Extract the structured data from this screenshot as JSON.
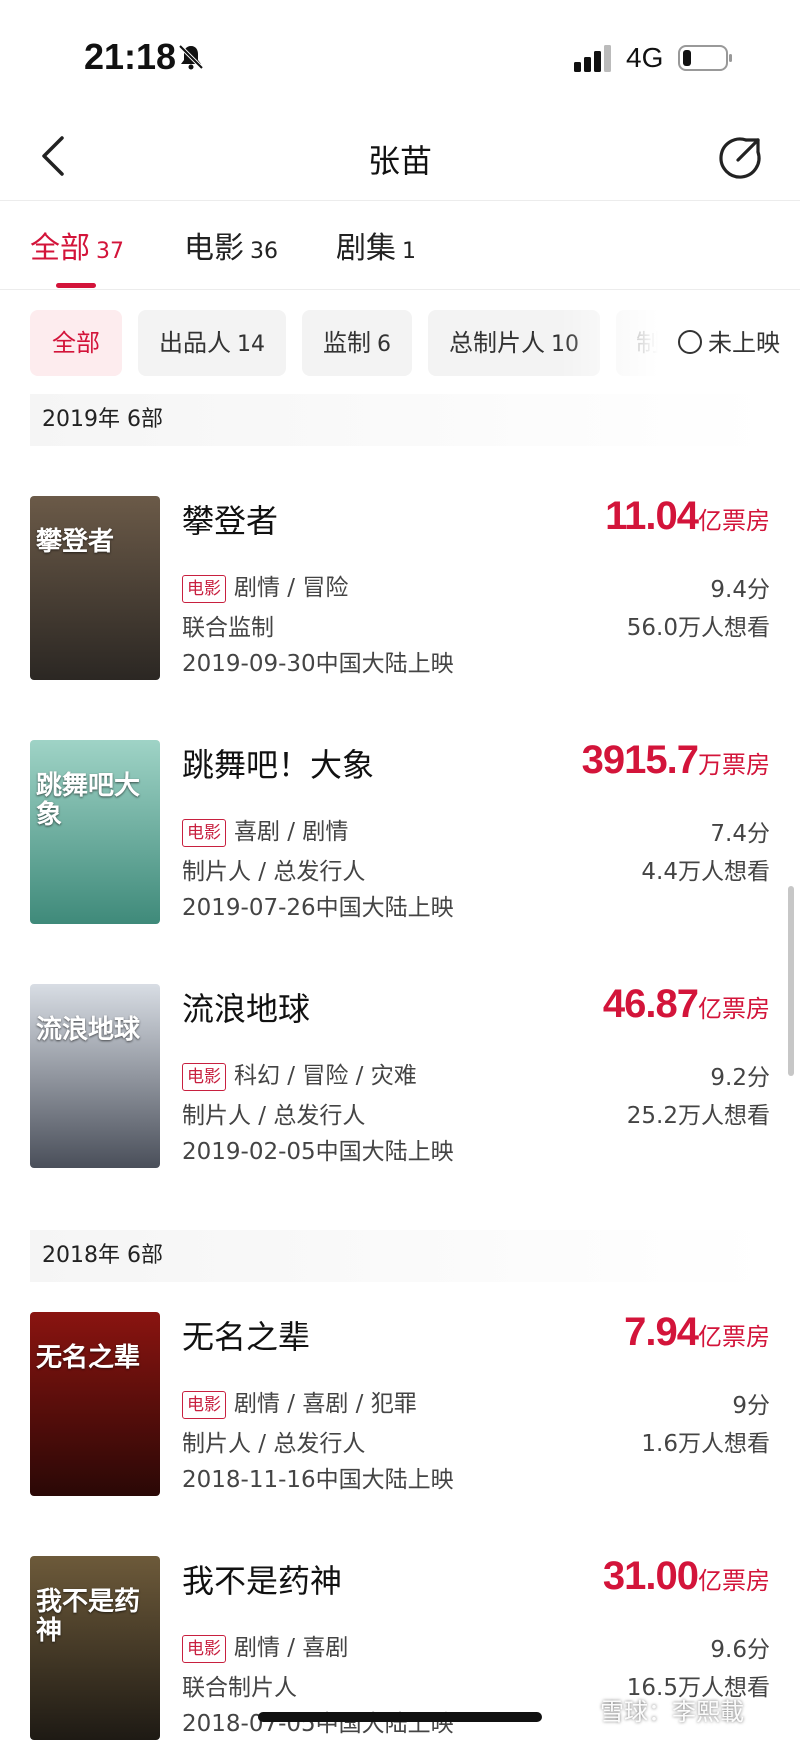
{
  "status_bar": {
    "time": "21:18",
    "network": "4G",
    "icons": [
      "bell-off-icon",
      "signal-icon",
      "battery-icon"
    ]
  },
  "nav": {
    "title": "张苗",
    "icons": [
      "back-icon",
      "share-icon"
    ]
  },
  "tabs": [
    {
      "label": "全部",
      "count": "37"
    },
    {
      "label": "电影",
      "count": "36"
    },
    {
      "label": "剧集",
      "count": "1"
    }
  ],
  "filters": [
    {
      "label": "全部",
      "count": ""
    },
    {
      "label": "出品人",
      "count": "14"
    },
    {
      "label": "监制",
      "count": "6"
    },
    {
      "label": "总制片人",
      "count": "10"
    },
    {
      "label": "制",
      "count": ""
    }
  ],
  "unreleased_toggle": "未上映",
  "groups": [
    {
      "header": "2019年  6部"
    },
    {
      "header": "2018年  6部"
    }
  ],
  "movies": [
    {
      "title": "攀登者",
      "box_value": "11.04",
      "box_unit": "亿票房",
      "badge": "电影",
      "genres": "剧情 / 冒险",
      "score": "9.4分",
      "role": "联合监制",
      "want": "56.0万人想看",
      "release": "2019-09-30中国大陆上映"
    },
    {
      "title": "跳舞吧！大象",
      "box_value": "3915.7",
      "box_unit": "万票房",
      "badge": "电影",
      "genres": "喜剧 / 剧情",
      "score": "7.4分",
      "role": "制片人 / 总发行人",
      "want": "4.4万人想看",
      "release": "2019-07-26中国大陆上映"
    },
    {
      "title": "流浪地球",
      "box_value": "46.87",
      "box_unit": "亿票房",
      "badge": "电影",
      "genres": "科幻 / 冒险 / 灾难",
      "score": "9.2分",
      "role": "制片人 / 总发行人",
      "want": "25.2万人想看",
      "release": "2019-02-05中国大陆上映"
    },
    {
      "title": "无名之辈",
      "box_value": "7.94",
      "box_unit": "亿票房",
      "badge": "电影",
      "genres": "剧情 / 喜剧 / 犯罪",
      "score": "9分",
      "role": "制片人 / 总发行人",
      "want": "1.6万人想看",
      "release": "2018-11-16中国大陆上映"
    },
    {
      "title": "我不是药神",
      "box_value": "31.00",
      "box_unit": "亿票房",
      "badge": "电影",
      "genres": "剧情 / 喜剧",
      "score": "9.6分",
      "role": "联合制片人",
      "want": "16.5万人想看",
      "release": "2018-07-05中国大陆上映"
    }
  ],
  "posters": [
    {
      "text": "攀登者",
      "colors": [
        "#6b5a48",
        "#2b2723"
      ]
    },
    {
      "text": "跳舞吧大象",
      "colors": [
        "#9fd3c6",
        "#3f8a7a"
      ]
    },
    {
      "text": "流浪地球",
      "colors": [
        "#d8dde4",
        "#4a4f5a"
      ]
    },
    {
      "text": "无名之辈",
      "colors": [
        "#8a1410",
        "#2a0806"
      ]
    },
    {
      "text": "我不是药神",
      "colors": [
        "#6d5a3a",
        "#1e1a14"
      ]
    }
  ],
  "watermark": "雪球：李熙載",
  "accent_color": "#d3143a"
}
